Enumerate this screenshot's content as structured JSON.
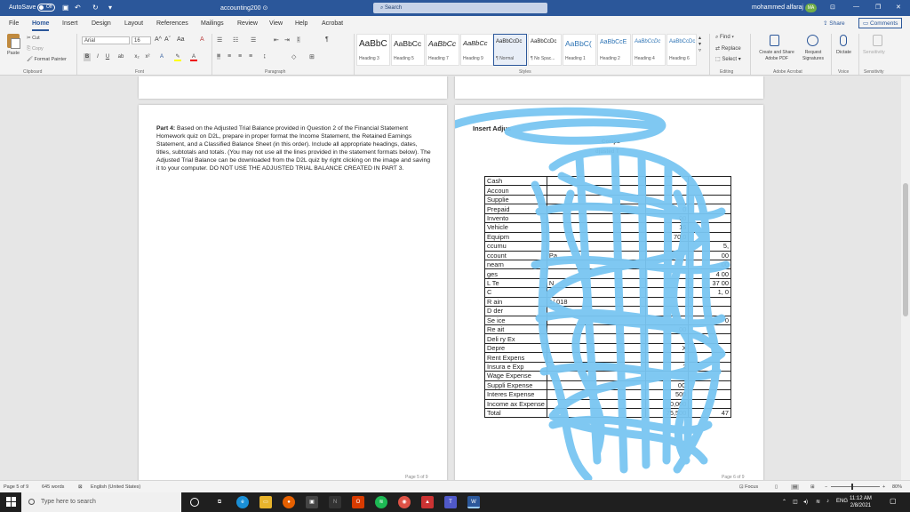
{
  "titlebar": {
    "autosave_label": "AutoSave",
    "autosave_state": "Off",
    "doc_name": "accounting200 ⊙",
    "search_placeholder": "Search",
    "user_name": "mohammed alfaraj",
    "user_initials": "MA"
  },
  "tabs": [
    "File",
    "Home",
    "Insert",
    "Design",
    "Layout",
    "References",
    "Mailings",
    "Review",
    "View",
    "Help",
    "Acrobat"
  ],
  "share_label": "Share",
  "comments_label": "Comments",
  "ribbon": {
    "clipboard": {
      "paste": "Paste",
      "cut": "Cut",
      "copy": "Copy",
      "format_painter": "Format Painter",
      "label": "Clipboard"
    },
    "font": {
      "family": "Arial",
      "size": "16",
      "label": "Font"
    },
    "paragraph_label": "Paragraph",
    "styles": [
      {
        "preview": "AaBbC",
        "name": "Heading 3"
      },
      {
        "preview": "AaBbCc",
        "name": "Heading 5"
      },
      {
        "preview": "AaBbCc",
        "name": "Heading 7"
      },
      {
        "preview": "AaBbCc",
        "name": "Heading 9"
      },
      {
        "preview": "AaBbCcDc",
        "name": "¶ Normal"
      },
      {
        "preview": "AaBbCcDc",
        "name": "¶ No Spac..."
      },
      {
        "preview": "AaBbC(",
        "name": "Heading 1"
      },
      {
        "preview": "AaBbCcE",
        "name": "Heading 2"
      },
      {
        "preview": "AaBbCcDc",
        "name": "Heading 4"
      },
      {
        "preview": "AaBbCcDc",
        "name": "Heading 6"
      }
    ],
    "styles_label": "Styles",
    "editing": {
      "find": "Find",
      "replace": "Replace",
      "select": "Select",
      "label": "Editing"
    },
    "adobe": {
      "create_share": "Create and Share Adobe PDF",
      "request_sig": "Request Signatures",
      "label": "Adobe Acrobat"
    },
    "voice": {
      "dictate": "Dictate",
      "label": "Voice"
    },
    "sensitivity": {
      "btn": "Sensitivity",
      "label": "Sensitivity"
    }
  },
  "page_left": {
    "part_label": "Part 4:",
    "body": " Based on the Adjusted Trial Balance provided in Question 2 of the Financial Statement Homework quiz on D2L, prepare in proper format the Income Statement, the Retained Earnings Statement, and a Classified Balance Sheet (in this order). Include all appropriate headings, dates, titles, subtotals and totals. (You may not use all the lines provided in the statement formats below). The Adjusted Trial Balance can be downloaded from the D2L quiz by right clicking on the image and saving it to your computer. DO NOT USE THE ADJUSTED TRIAL BALANCE CREATED IN PART 3.",
    "page_num": "Page 5 of 9"
  },
  "page_right": {
    "insert_title": "Insert Adjus",
    "company_fragment": "Compa",
    "heading_fragment": "djusted T",
    "page_num": "Page 6 of 9",
    "rows": [
      [
        "Cash",
        "",
        "",
        ""
      ],
      [
        "Accoun",
        "",
        "",
        ""
      ],
      [
        "Supplie",
        "",
        "",
        ""
      ],
      [
        "Prepaid",
        "",
        "0",
        ""
      ],
      [
        "Invento",
        "",
        "00",
        ""
      ],
      [
        "Vehicle",
        "",
        "16",
        ""
      ],
      [
        "Equipm",
        "",
        "70,0",
        ""
      ],
      [
        "ccumu",
        "",
        "",
        "5,"
      ],
      [
        "ccount",
        "Pa",
        "",
        "00"
      ],
      [
        "nearn",
        "",
        "",
        "00"
      ],
      [
        "ges",
        "",
        "",
        "4 00"
      ],
      [
        "L Te",
        "N",
        "",
        "37 00"
      ],
      [
        "C",
        "",
        "",
        "1, 0"
      ],
      [
        "R ain",
        "1/ 018",
        "",
        ""
      ],
      [
        "D der",
        "",
        "",
        ""
      ],
      [
        "Se ice",
        "",
        "",
        "0"
      ],
      [
        "Re ait",
        "",
        "00",
        ""
      ],
      [
        "Deli ry Ex",
        "",
        "",
        ""
      ],
      [
        "Depre",
        "",
        "X",
        ""
      ],
      [
        "Rent Expens",
        "",
        "",
        ""
      ],
      [
        "Insura e Exp",
        "",
        "2",
        ""
      ],
      [
        "Wage Expense",
        "",
        "",
        ""
      ],
      [
        "Suppli Expense",
        "",
        "0C",
        ""
      ],
      [
        "Interes Expense",
        "",
        "500",
        ""
      ],
      [
        "Income ax Expense",
        "",
        "0,000",
        ""
      ],
      [
        "Total",
        "",
        "75,500",
        "47"
      ]
    ]
  },
  "statusbar": {
    "page": "Page 5 of 9",
    "words": "645 words",
    "language": "English (United States)",
    "focus": "Focus",
    "zoom": "80%"
  },
  "taskbar": {
    "search_placeholder": "Type here to search",
    "lang": "ENG",
    "time": "11:12 AM",
    "date": "2/8/2021"
  }
}
